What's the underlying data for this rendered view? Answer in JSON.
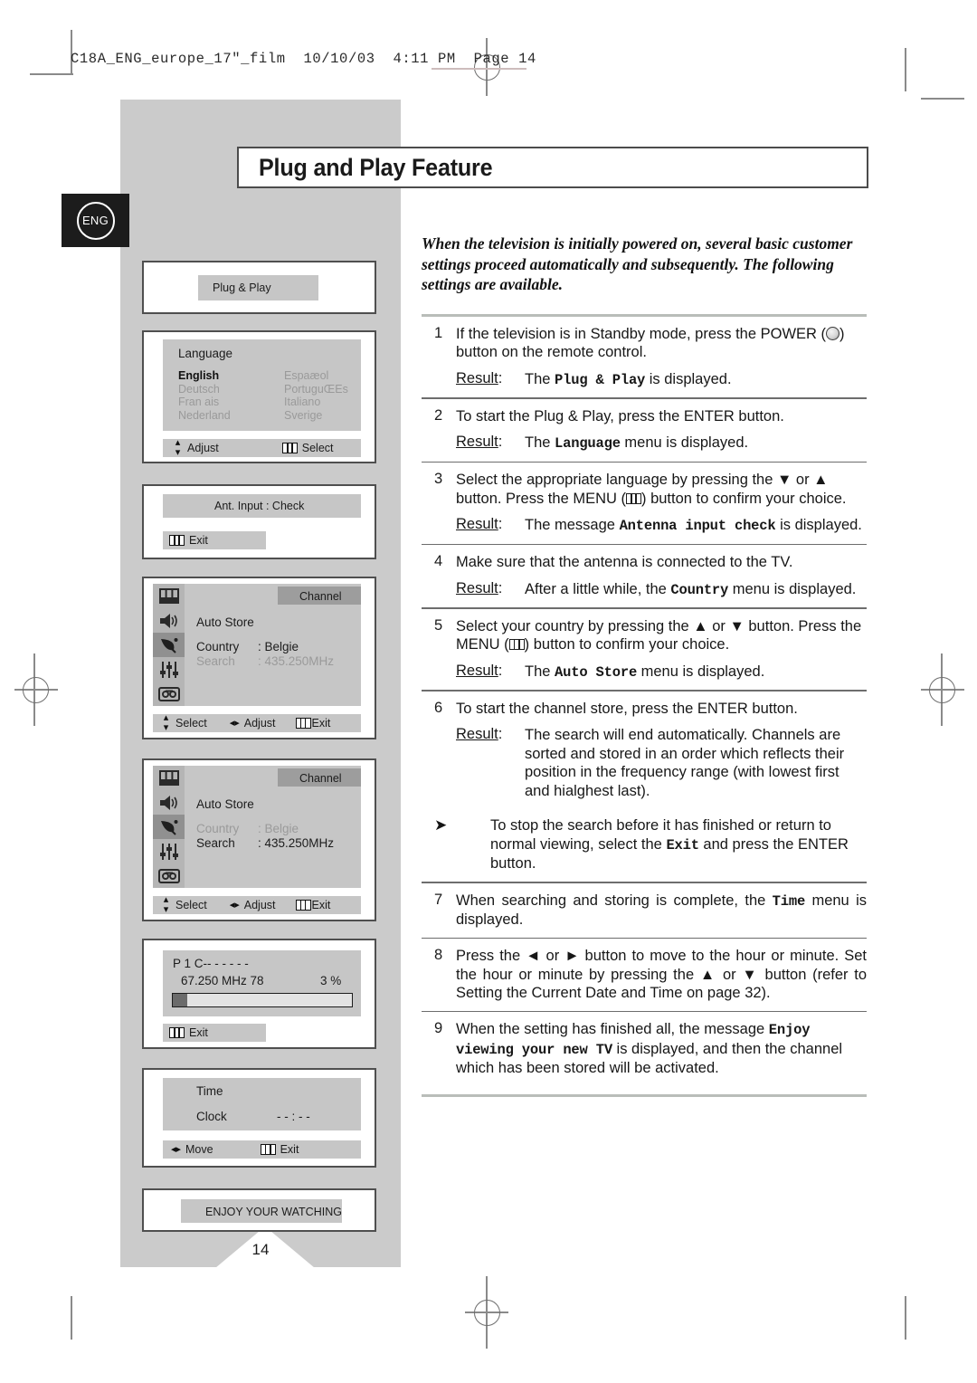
{
  "file_header": "C18A_ENG_europe_17\"_film  10/10/03  4:11 PM  Page 14",
  "language_tab": "ENG",
  "page_number": "14",
  "page_title": "Plug and Play Feature",
  "intro": "When the television is initially powered on, several basic customer settings proceed automatically and subsequently. The following settings are available.",
  "result_label": "Result",
  "steps": [
    {
      "num": "1",
      "text_before": "If the television is in Standby mode, press the POWER (",
      "text_after": ") button on the remote control.",
      "icon": "power-icon",
      "result_before": "The ",
      "result_mono": "Plug & Play",
      "result_after": " is displayed."
    },
    {
      "num": "2",
      "text": "To start the Plug & Play, press the ENTER button.",
      "result_before": "The ",
      "result_mono": "Language",
      "result_after": " menu is displayed."
    },
    {
      "num": "3",
      "text_before": "Select the appropriate language by pressing the ▼ or ▲ button. Press the MENU (",
      "text_after": ") button to confirm your choice.",
      "icon": "menu-icon",
      "result_before": "The message ",
      "result_mono": "Antenna input check",
      "result_after": " is displayed."
    },
    {
      "num": "4",
      "text": "Make sure that the antenna is connected to the TV.",
      "result_before": "After a little while, the ",
      "result_mono": "Country",
      "result_after": " menu is displayed."
    },
    {
      "num": "5",
      "text_before": "Select your country by pressing the ▲ or ▼ button. Press the MENU (",
      "text_after": ") button to confirm your choice.",
      "icon": "menu-icon",
      "result_before": "The ",
      "result_mono": "Auto Store",
      "result_after": " menu is displayed."
    },
    {
      "num": "6",
      "text": "To start the channel store, press the ENTER button.",
      "result_before": "The search will end automatically. Channels are sorted and stored in an order which reflects their position in the frequency range (with lowest first and hialghest last).",
      "result_mono": "",
      "result_after": ""
    }
  ],
  "note": {
    "bullet": "➤",
    "text_before": "To stop the search before it has finished or return to normal viewing, select the ",
    "mono": "Exit",
    "text_after": " and press the ENTER button."
  },
  "steps_tail": [
    {
      "num": "7",
      "text_before": "When searching and storing is complete, the ",
      "mono": "Time",
      "text_after": " menu is displayed."
    },
    {
      "num": "8",
      "text": "Press the ◄ or ► button to move to the hour or minute. Set the hour or minute by pressing the ▲ or ▼ button (refer to  Setting the Current Date and Time  on page 32)."
    },
    {
      "num": "9",
      "text_before": "When the setting has finished all, the message ",
      "mono": "Enjoy viewing your new TV",
      "text_after": " is displayed, and then the channel which has been stored will be activated."
    }
  ],
  "osd": {
    "plug_play": {
      "title": "Plug  &  Play"
    },
    "language": {
      "heading": "Language",
      "left_column": [
        "English",
        "Deutsch",
        "Fran ais",
        "Nederland"
      ],
      "right_column": [
        "Espaæol",
        "PortuguŒEs",
        "Italiano",
        "Sverige"
      ],
      "selected": "English",
      "footer": [
        {
          "icon": "up-down-arrow-icon",
          "label": "Adjust"
        },
        {
          "icon": "menu-icon",
          "label": "Select"
        }
      ]
    },
    "ant_input": {
      "title": "Ant. Input : Check",
      "footer": [
        {
          "icon": "menu-icon",
          "label": "Exit"
        }
      ]
    },
    "channel_country": {
      "tab": "Channel",
      "rows": [
        {
          "label": "Auto Store",
          "value": "",
          "state": "active"
        },
        {
          "label": "Country",
          "value": ": Belgie",
          "state": "active"
        },
        {
          "label": "Search",
          "value": ": 435.250MHz",
          "state": "dim"
        }
      ],
      "rail_icons": [
        "picture-menu-icon",
        "speaker-icon",
        "satellite-dish-icon",
        "equalizer-icon",
        "tape-icon"
      ],
      "rail_active": "satellite-dish-icon",
      "footer": [
        {
          "icon": "up-down-arrow-icon",
          "label": "Select"
        },
        {
          "icon": "left-right-arrow-icon",
          "label": "Adjust"
        },
        {
          "icon": "menu-icon",
          "label": "Exit"
        }
      ]
    },
    "channel_search": {
      "tab": "Channel",
      "rows": [
        {
          "label": "Auto Store",
          "value": "",
          "state": "active"
        },
        {
          "label": "Country",
          "value": ": Belgie",
          "state": "dim"
        },
        {
          "label": "Search",
          "value": ": 435.250MHz",
          "state": "active"
        }
      ],
      "rail_icons": [
        "picture-menu-icon",
        "speaker-icon",
        "satellite-dish-icon",
        "equalizer-icon",
        "tape-icon"
      ],
      "rail_active": "satellite-dish-icon",
      "footer": [
        {
          "icon": "up-down-arrow-icon",
          "label": "Select"
        },
        {
          "icon": "left-right-arrow-icon",
          "label": "Adjust"
        },
        {
          "icon": "menu-icon",
          "label": "Exit"
        }
      ]
    },
    "search_progress": {
      "channel_line": "P 1 C--  - - - - -",
      "frequency": "67.250 MHz  78",
      "percent": "3 %",
      "progress_value": 3,
      "footer": [
        {
          "icon": "menu-icon",
          "label": "Exit"
        }
      ]
    },
    "time": {
      "heading": "Time",
      "clock_label": "Clock",
      "clock_value": "- - : - -",
      "footer": [
        {
          "icon": "left-right-arrow-icon",
          "label": "Move"
        },
        {
          "icon": "menu-icon",
          "label": "Exit"
        }
      ]
    },
    "enjoy": {
      "message": "ENJOY YOUR WATCHING"
    }
  },
  "colors": {
    "panel_grey": "#cbcbcb",
    "osd_band": "#c6c6c6",
    "osd_tab": "#9d9d9d",
    "rail": "#b5b5b5",
    "rail_active": "#909090",
    "eng_tab": "#1c1c1c",
    "rule_thick": "#b9bdb9"
  }
}
